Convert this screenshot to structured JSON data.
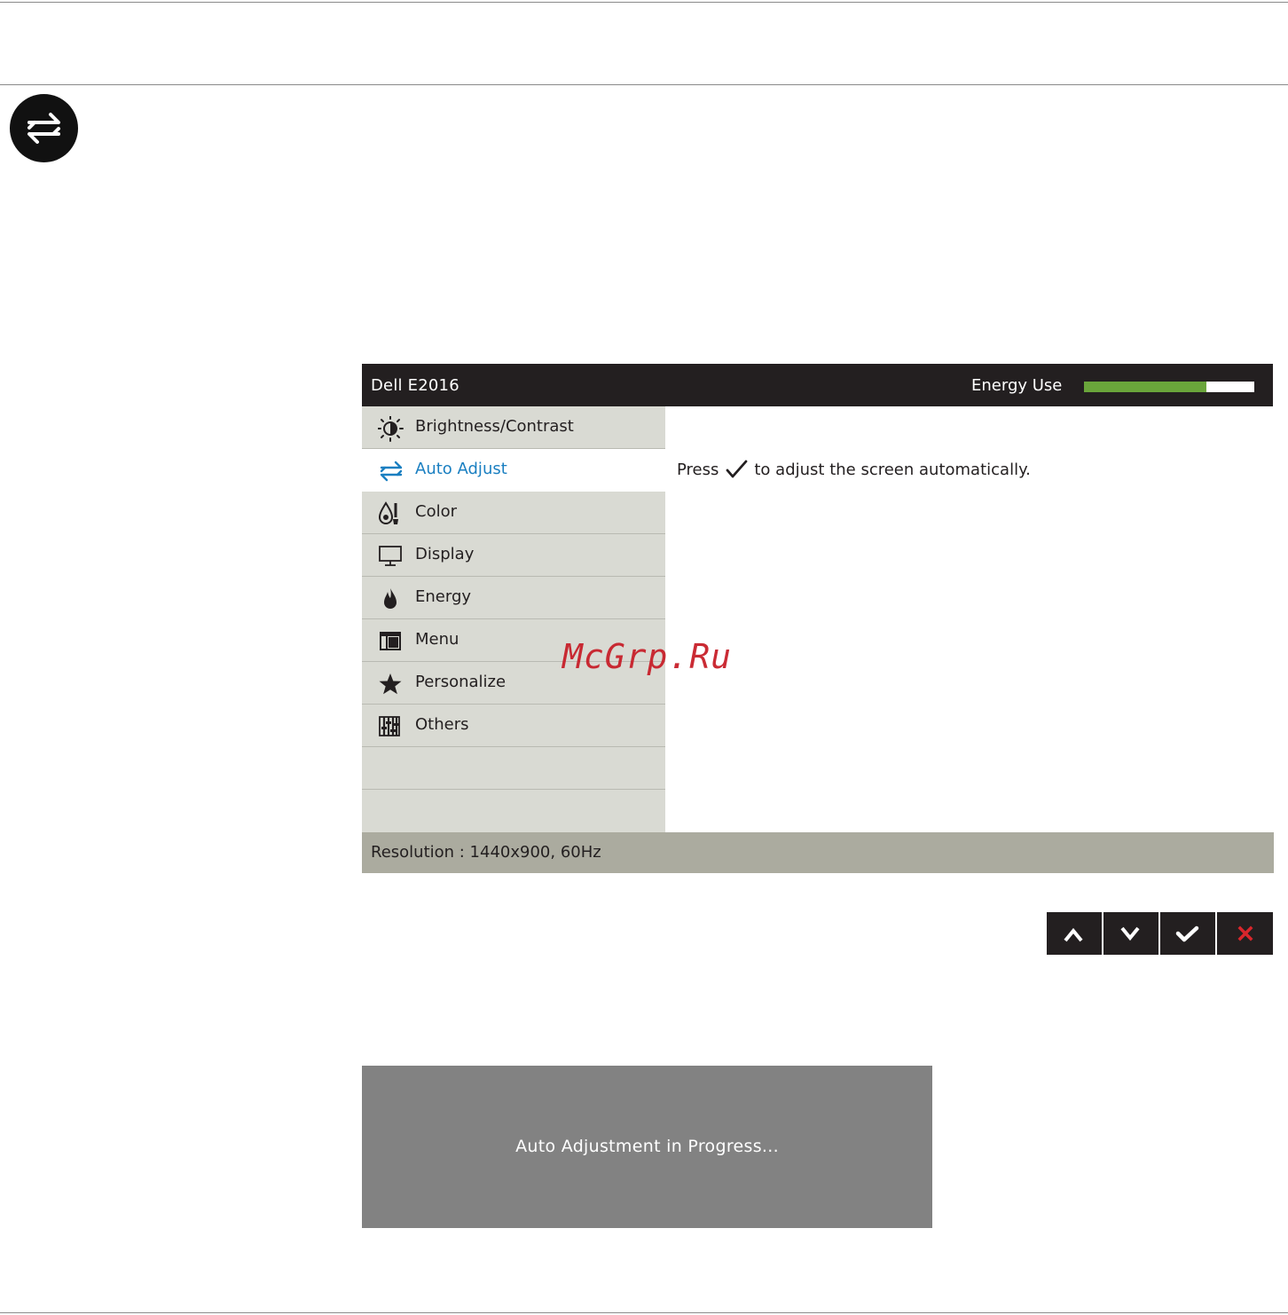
{
  "osd": {
    "model": "Dell E2016",
    "energy_label": "Energy Use",
    "energy_level": 0.72,
    "energy_color": "#6aa53b",
    "menu_items": [
      {
        "label": "Brightness/Contrast",
        "icon": "brightness-icon",
        "active": false
      },
      {
        "label": "Auto Adjust",
        "icon": "auto-adjust-icon",
        "active": true
      },
      {
        "label": "Color",
        "icon": "color-icon",
        "active": false
      },
      {
        "label": "Display",
        "icon": "display-icon",
        "active": false
      },
      {
        "label": "Energy",
        "icon": "energy-icon",
        "active": false
      },
      {
        "label": "Menu",
        "icon": "menu-icon",
        "active": false
      },
      {
        "label": "Personalize",
        "icon": "star-icon",
        "active": false
      },
      {
        "label": "Others",
        "icon": "others-icon",
        "active": false
      }
    ],
    "instruction_before": "Press",
    "instruction_after": "to adjust the screen automatically.",
    "resolution": "Resolution : 1440x900, 60Hz",
    "active_color": "#1a7fc1"
  },
  "buttons": [
    {
      "name": "up-button",
      "icon": "chevron-up-icon"
    },
    {
      "name": "down-button",
      "icon": "chevron-down-icon"
    },
    {
      "name": "ok-button",
      "icon": "check-icon"
    },
    {
      "name": "exit-button",
      "icon": "close-icon",
      "color": "#d9262c"
    }
  ],
  "progress": {
    "message": "Auto Adjustment in Progress..."
  },
  "watermark": "McGrp.Ru"
}
